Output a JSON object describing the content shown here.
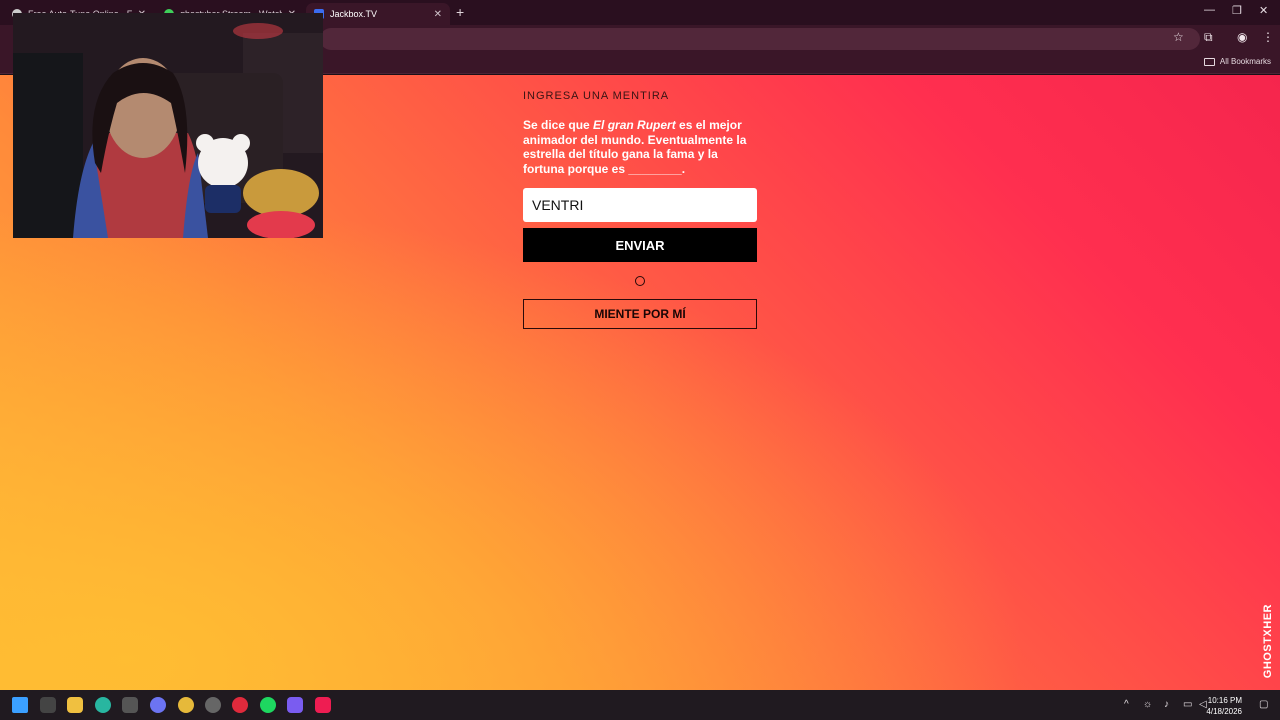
{
  "browser": {
    "tabs": [
      {
        "title": "Free Auto-Tune Online - Fluid"
      },
      {
        "title": "ghostxher Stream - Watch Live"
      },
      {
        "title": "Jackbox.TV"
      }
    ],
    "new_tab": "+",
    "bookmarks_label": "All Bookmarks"
  },
  "game": {
    "prompt_label": "INGRESA UNA MENTIRA",
    "question_prefix": "Se dice que ",
    "question_film": "El gran Rupert",
    "question_suffix": " es el mejor animador del mundo. Eventualmente la estrella del título gana la fama y la fortuna porque es ________.",
    "answer_value": "VENTRI",
    "send_label": "ENVIAR",
    "lie_for_me_label": "MIENTE POR MÍ"
  },
  "watermark": "GHOSTXHER",
  "taskbar": {
    "time": "10:16 PM",
    "date": "4/18/2026"
  },
  "colors": {
    "accent_red": "#ff2f4f",
    "accent_orange": "#ffb338",
    "chrome_bg": "#3a1628"
  }
}
